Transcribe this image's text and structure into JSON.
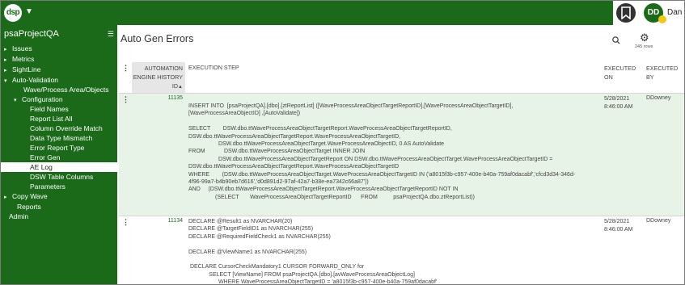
{
  "topbar": {
    "logo_text": "dsp",
    "user_initials": "DD",
    "user_name": "Dan"
  },
  "sidebar": {
    "title": "psaProjectQA",
    "items": [
      {
        "label": "Issues",
        "arrow": "▸"
      },
      {
        "label": "Metrics",
        "arrow": "▸"
      },
      {
        "label": "SightLine",
        "arrow": "▸"
      },
      {
        "label": "Auto-Validation",
        "arrow": "▾"
      },
      {
        "label": "Wave/Process Area/Objects",
        "arrow": ""
      },
      {
        "label": "Configuration",
        "arrow": "▾"
      },
      {
        "label": "Field Names",
        "arrow": ""
      },
      {
        "label": "Report List All",
        "arrow": ""
      },
      {
        "label": "Column Override Match",
        "arrow": ""
      },
      {
        "label": "Data Type Mismatch",
        "arrow": ""
      },
      {
        "label": "Error Report Type",
        "arrow": ""
      },
      {
        "label": "Error Gen",
        "arrow": ""
      },
      {
        "label": "AE Log",
        "arrow": ""
      },
      {
        "label": "DSW Table Columns",
        "arrow": ""
      },
      {
        "label": "Parameters",
        "arrow": ""
      },
      {
        "label": "Copy Wave",
        "arrow": "▸"
      },
      {
        "label": "Reports",
        "arrow": ""
      },
      {
        "label": "Admin",
        "arrow": ""
      }
    ]
  },
  "main": {
    "title": "Auto Gen Errors",
    "rows_count": "245 rows"
  },
  "table": {
    "headers": {
      "id": "AUTOMATION ENGINE HISTORY ID",
      "step": "EXECUTION STEP",
      "executed_on": "EXECUTED ON",
      "executed_by": "EXECUTED BY"
    },
    "rows": [
      {
        "id": "11135",
        "step": "INSERT INTO  [psaProjectQA].[dbo].[ztReportList] ([WaveProcessAreaObjectTargetReportID],[WaveProcessAreaObjectTargetID],\n[WaveProcessAreaObjectID] ,[AutoValidate])\n\nSELECT        DSW.dbo.ttWaveProcessAreaObjectTargetReport.WaveProcessAreaObjectTargetReportID,\nDSW.dbo.ttWaveProcessAreaObjectTargetReport.WaveProcessAreaObjectTargetID,\n                   DSW.dbo.ttWaveProcessAreaObjectTarget.WaveProcessAreaObjectID, 0 AS AutoValidate\nFROM            DSW.dbo.ttWaveProcessAreaObjectTarget INNER JOIN\n                   DSW.dbo.ttWaveProcessAreaObjectTargetReport ON DSW.dbo.ttWaveProcessAreaObjectTarget.WaveProcessAreaObjectTargetID =\nDSW.dbo.ttWaveProcessAreaObjectTargetReport.WaveProcessAreaObjectTargetID\nWHERE        (DSW.dbo.ttWaveProcessAreaObjectTarget.WaveProcessAreaObjectTargetID IN ('a8015f3b-c957-400e-b40a-759af0dacabf','cfcd3d34-346d-\n4f96-99a7-b4b90eb7d616','d0d891d2-97af-42a7-b38e-ea7342c66a87'))\nAND     (DSW.dbo.ttWaveProcessAreaObjectTargetReport.WaveProcessAreaObjectTargetReportID NOT IN\n                 (SELECT       WaveProcessAreaObjectTargetReportID      FROM          psaProjectQA.dbo.ztReportList))",
        "executed_on": "5/28/2021\n8:46:00 AM",
        "executed_by": "DDowney"
      },
      {
        "id": "11134",
        "step": "DECLARE @Result1 as NVARCHAR(20)\nDECLARE @TargetFieldID1 as NVARCHAR(255)\nDECLARE @RequiredFieldCheck1 as NVARCHAR(255)\n\nDECLARE @ViewName1 as NVARCHAR(255)\n\n DECLARE CursorCheckMandatory1 CURSOR FORWARD_ONLY for\n             SELECT [ViewName] FROM psaProjectQA.[dbo].[avWaveProcessAreaObjectLog]\n                   WHERE WaveProcessAreaObjectTargetID = 'a8015f3b-c957-400e-b40a-759af0dacabf'",
        "executed_on": "5/28/2021\n8:46:00 AM",
        "executed_by": "DDowney"
      }
    ]
  }
}
